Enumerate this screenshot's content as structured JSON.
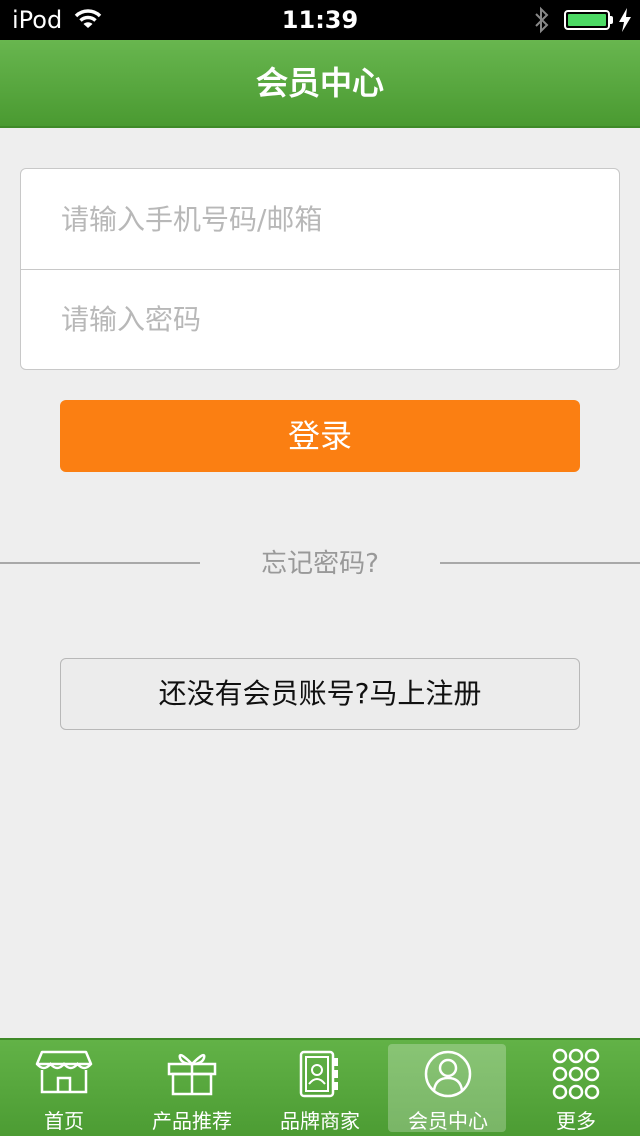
{
  "status_bar": {
    "carrier": "iPod",
    "time": "11:39",
    "wifi_icon": "wifi-icon",
    "bluetooth_icon": "bluetooth-icon",
    "battery_icon": "battery-icon",
    "charging_icon": "charging-icon",
    "battery_level": 1.0
  },
  "header": {
    "title": "会员中心"
  },
  "login_form": {
    "username_placeholder": "请输入手机号码/邮箱",
    "username_value": "",
    "password_placeholder": "请输入密码",
    "password_value": "",
    "login_label": "登录"
  },
  "forgot_password": "忘记密码?",
  "register_label": "还没有会员账号?马上注册",
  "tab_bar": {
    "items": [
      {
        "label": "首页",
        "icon": "storefront-icon",
        "active": false
      },
      {
        "label": "产品推荐",
        "icon": "gift-icon",
        "active": false
      },
      {
        "label": "品牌商家",
        "icon": "contacts-book-icon",
        "active": false
      },
      {
        "label": "会员中心",
        "icon": "user-icon",
        "active": true
      },
      {
        "label": "更多",
        "icon": "grid-dots-icon",
        "active": false
      }
    ]
  },
  "colors": {
    "nav_green": "#5aa83f",
    "login_orange": "#fb7f12",
    "background": "#eeeeee"
  }
}
